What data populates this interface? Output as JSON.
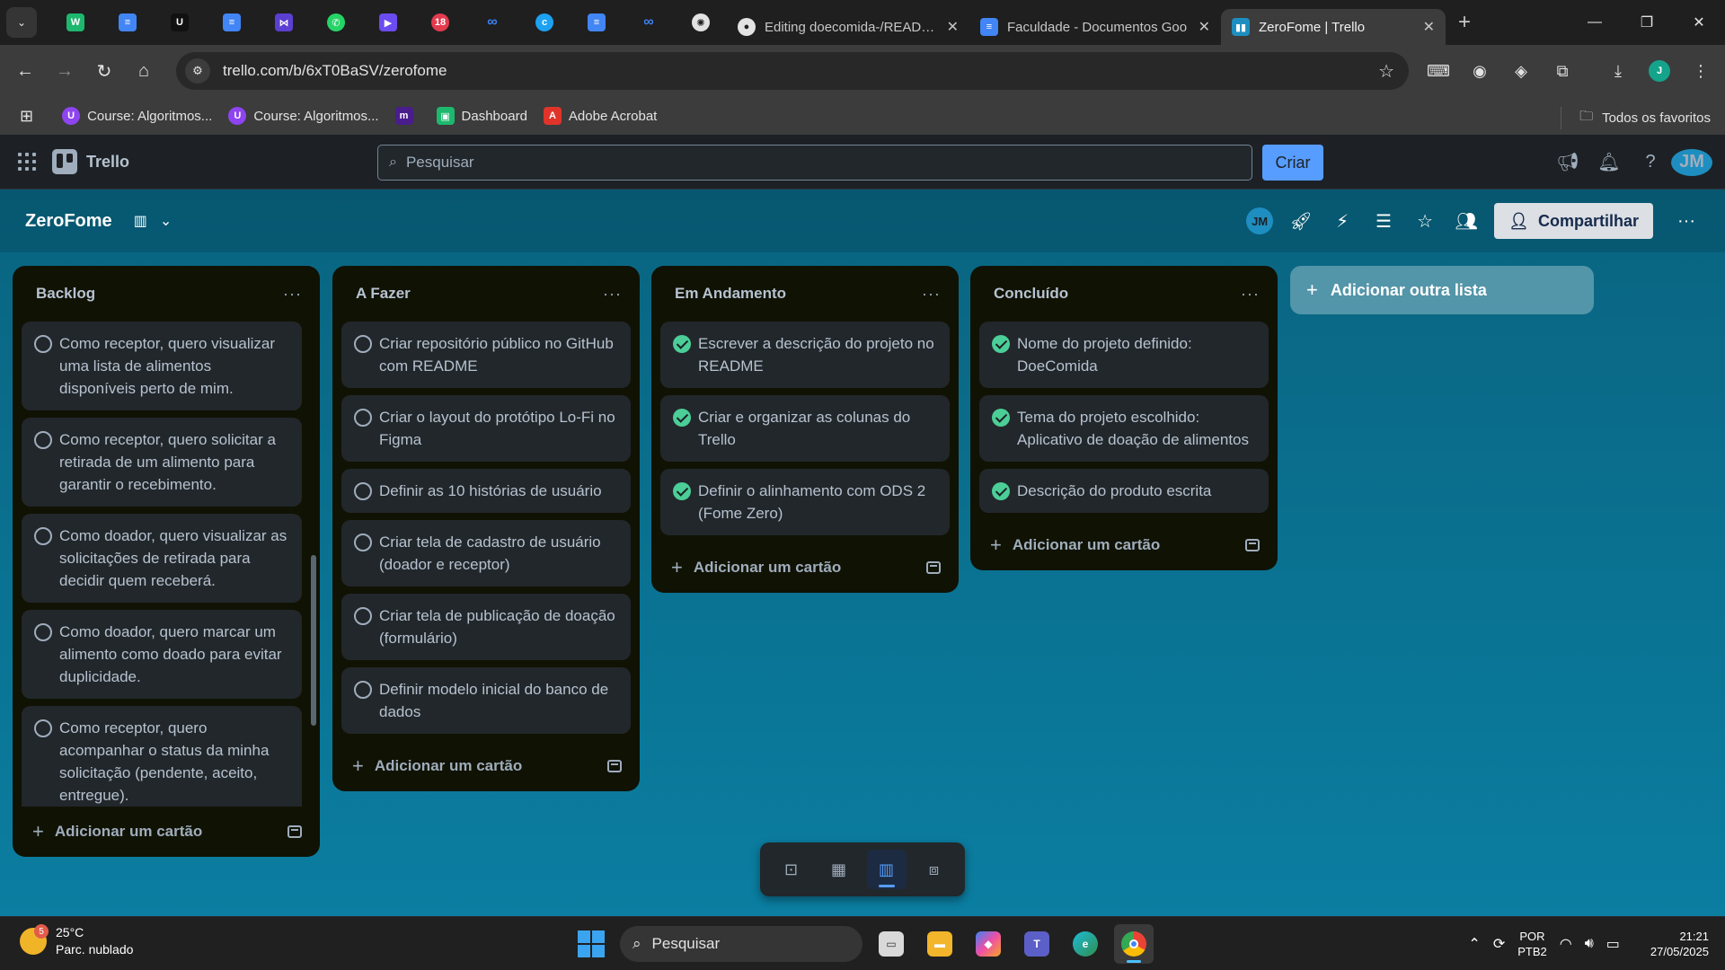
{
  "browser": {
    "tabs": [
      {
        "title": "Editing doecomida-/README",
        "close": "✕"
      },
      {
        "title": "Faculdade - Documentos Goo",
        "close": "✕"
      },
      {
        "title": "ZeroFome | Trello",
        "close": "✕"
      }
    ],
    "new_tab": "+",
    "url": "trello.com/b/6xT0BaSV/zerofome",
    "bookmarks": [
      {
        "label": "Course: Algoritmos...",
        "color": "#8e44ef"
      },
      {
        "label": "Course: Algoritmos...",
        "color": "#8e44ef"
      },
      {
        "label": "",
        "color": "#4a1d8c"
      },
      {
        "label": "Dashboard",
        "color": "#1eb76e"
      },
      {
        "label": "Adobe Acrobat",
        "color": "#e0342b"
      }
    ],
    "all_bookmarks": "Todos os favoritos"
  },
  "trello": {
    "app_name": "Trello",
    "search_placeholder": "Pesquisar",
    "create_label": "Criar",
    "avatar": "JM"
  },
  "board": {
    "title": "ZeroFome",
    "share_label": "Compartilhar",
    "member_avatar": "JM",
    "add_list_label": "Adicionar outra lista",
    "add_card_label": "Adicionar um cartão",
    "lists": [
      {
        "title": "Backlog",
        "cards": [
          {
            "text": "Como receptor, quero visualizar uma lista de alimentos disponíveis perto de mim.",
            "done": false
          },
          {
            "text": "Como receptor, quero solicitar a retirada de um alimento para garantir o recebimento.",
            "done": false
          },
          {
            "text": "Como doador, quero visualizar as solicitações de retirada para decidir quem receberá.",
            "done": false
          },
          {
            "text": "Como doador, quero marcar um alimento como doado para evitar duplicidade.",
            "done": false
          },
          {
            "text": "Como receptor, quero acompanhar o status da minha solicitação (pendente, aceito, entregue).",
            "done": false
          }
        ]
      },
      {
        "title": "A Fazer",
        "cards": [
          {
            "text": "Criar repositório público no GitHub com README",
            "done": false
          },
          {
            "text": "Criar o layout do protótipo Lo-Fi no Figma",
            "done": false
          },
          {
            "text": "Definir as 10 histórias de usuário",
            "done": false
          },
          {
            "text": "Criar tela de cadastro de usuário (doador e receptor)",
            "done": false
          },
          {
            "text": "Criar tela de publicação de doação (formulário)",
            "done": false
          },
          {
            "text": "Definir modelo inicial do banco de dados",
            "done": false
          }
        ]
      },
      {
        "title": "Em Andamento",
        "cards": [
          {
            "text": "Escrever a descrição do projeto no README",
            "done": true
          },
          {
            "text": "Criar e organizar as colunas do Trello",
            "done": true
          },
          {
            "text": "Definir o alinhamento com ODS 2 (Fome Zero)",
            "done": true
          }
        ]
      },
      {
        "title": "Concluído",
        "cards": [
          {
            "text": "Nome do projeto definido: DoeComida",
            "done": true
          },
          {
            "text": "Tema do projeto escolhido: Aplicativo de doação de alimentos",
            "done": true
          },
          {
            "text": "Descrição do produto escrita",
            "done": true
          }
        ]
      }
    ]
  },
  "taskbar": {
    "weather_temp": "25°C",
    "weather_desc": "Parc. nublado",
    "weather_badge": "5",
    "search_placeholder": "Pesquisar",
    "lang_1": "POR",
    "lang_2": "PTB2",
    "time": "21:21",
    "date": "27/05/2025"
  },
  "colors": {
    "board_bg": "#0b7ea1",
    "list_bg": "#101204",
    "card_bg": "#22272b",
    "done_green": "#4bce97",
    "accent_blue": "#579dff"
  }
}
